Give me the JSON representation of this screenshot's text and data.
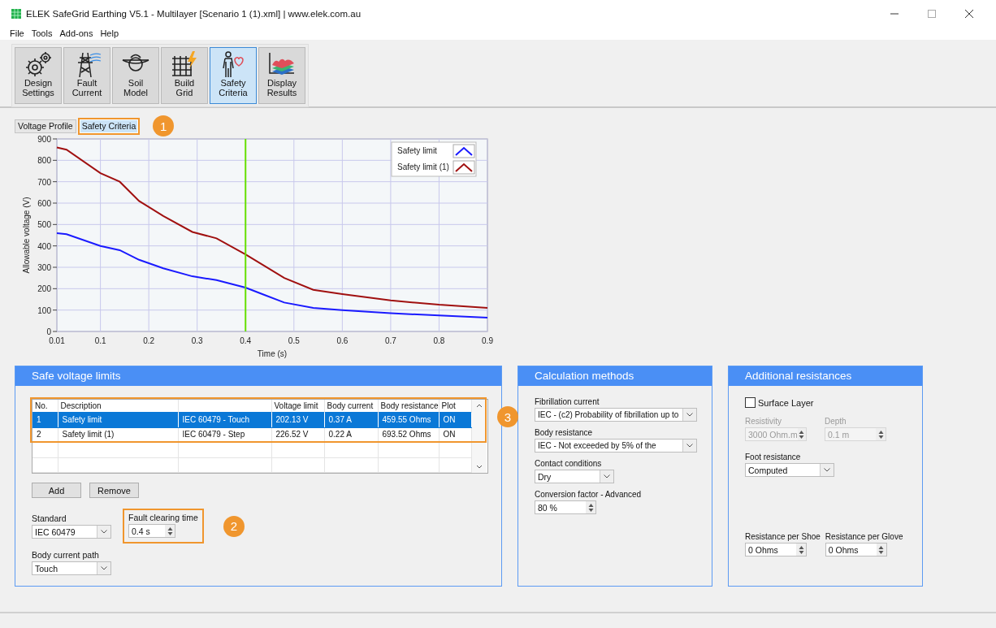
{
  "window": {
    "title": "ELEK SafeGrid Earthing V5.1 - Multilayer [Scenario 1 (1).xml] | www.elek.com.au"
  },
  "menu": [
    "File",
    "Tools",
    "Add-ons",
    "Help"
  ],
  "toolbar": [
    {
      "label": "Design Settings",
      "kind": "gear",
      "selected": false
    },
    {
      "label": "Fault Current",
      "kind": "tower",
      "selected": false
    },
    {
      "label": "Soil Model",
      "kind": "soil",
      "selected": false
    },
    {
      "label": "Build Grid",
      "kind": "grid",
      "selected": false
    },
    {
      "label": "Safety Criteria",
      "kind": "person",
      "selected": true
    },
    {
      "label": "Display Results",
      "kind": "layers",
      "selected": false
    }
  ],
  "tabs": [
    {
      "label": "Voltage Profile",
      "selected": false
    },
    {
      "label": "Safety Criteria",
      "selected": true
    }
  ],
  "callouts": [
    "1",
    "2",
    "3"
  ],
  "chart": {
    "chart_data": {
      "type": "line",
      "xlabel": "Time (s)",
      "ylabel": "Allowable voltage (V)",
      "x": [
        0.01,
        0.03,
        0.1,
        0.14,
        0.18,
        0.23,
        0.29,
        0.34,
        0.4,
        0.44,
        0.48,
        0.54,
        0.6,
        0.7,
        0.8,
        0.9
      ],
      "series": [
        {
          "name": "Safety limit",
          "color": "#1a1aff",
          "values": [
            460,
            455,
            400,
            380,
            335,
            295,
            258,
            240,
            205,
            170,
            135,
            110,
            100,
            85,
            75,
            65
          ]
        },
        {
          "name": "Safety limit (1)",
          "color": "#a01010",
          "values": [
            860,
            850,
            740,
            700,
            610,
            540,
            465,
            435,
            360,
            305,
            250,
            195,
            175,
            145,
            125,
            110
          ]
        }
      ],
      "xlim": [
        0.01,
        0.9
      ],
      "ylim": [
        0,
        900
      ],
      "xticks": [
        0.01,
        0.1,
        0.2,
        0.3,
        0.4,
        0.5,
        0.6,
        0.7,
        0.8,
        0.9
      ],
      "yticks": [
        0,
        100,
        200,
        300,
        400,
        500,
        600,
        700,
        800,
        900
      ],
      "grid": true,
      "legend": true,
      "ref_lines": [
        {
          "axis": "x",
          "value": 0.4,
          "color": "#66e000"
        }
      ]
    }
  },
  "safe_voltage_limits": {
    "title": "Safe voltage limits",
    "table": {
      "columns": [
        "No.",
        "Description",
        "",
        "Voltage limit",
        "Body current",
        "Body resistance",
        "Plot"
      ],
      "rows": [
        {
          "cells": [
            "1",
            "Safety limit",
            "IEC 60479 - Touch",
            "202.13 V",
            "0.37 A",
            "459.55 Ohms",
            "ON"
          ],
          "selected": true
        },
        {
          "cells": [
            "2",
            "Safety limit (1)",
            "IEC 60479 - Step",
            "226.52 V",
            "0.22 A",
            "693.52 Ohms",
            "ON"
          ],
          "selected": false
        }
      ]
    },
    "buttons": [
      "Add",
      "Remove"
    ],
    "standard": {
      "label": "Standard",
      "value": "IEC 60479"
    },
    "fault_clearing_time": {
      "label": "Fault clearing time",
      "value": "0.4 s"
    },
    "body_current_path": {
      "label": "Body current path",
      "value": "Touch"
    }
  },
  "calculation_methods": {
    "title": "Calculation methods",
    "rows": [
      [
        {
          "label": "Fibrillation current",
          "value": "IEC - (c2) Probability of fibrillation up to",
          "kind": "dropdown",
          "disabled": false
        }
      ],
      [
        {
          "label": "Body resistance",
          "value": "IEC - Not exceeded by 5% of the",
          "kind": "dropdown",
          "disabled": false
        }
      ],
      [
        {
          "label": "Contact conditions",
          "value": "Dry",
          "kind": "dropdown",
          "disabled": false
        }
      ],
      [
        {
          "label": "Conversion factor - Advanced",
          "value": "80 %",
          "kind": "spinner",
          "disabled": false
        }
      ]
    ]
  },
  "additional_resistances": {
    "title": "Additional resistances",
    "surface_layer": {
      "label": "Surface Layer",
      "checked": false
    },
    "rows": [
      [
        {
          "label": "Resistivity",
          "value": "3000 Ohm.m",
          "kind": "spinner",
          "disabled": true
        },
        {
          "label": "Depth",
          "value": "0.1 m",
          "kind": "spinner",
          "disabled": true
        }
      ],
      [
        {
          "label": "Foot resistance",
          "value": "Computed",
          "kind": "dropdown",
          "disabled": false
        }
      ],
      [
        {
          "label": "Resistance per Shoe",
          "value": "0 Ohms",
          "kind": "spinner",
          "disabled": false
        },
        {
          "label": "Resistance per Glove",
          "value": "0 Ohms",
          "kind": "spinner",
          "disabled": false
        }
      ]
    ]
  }
}
